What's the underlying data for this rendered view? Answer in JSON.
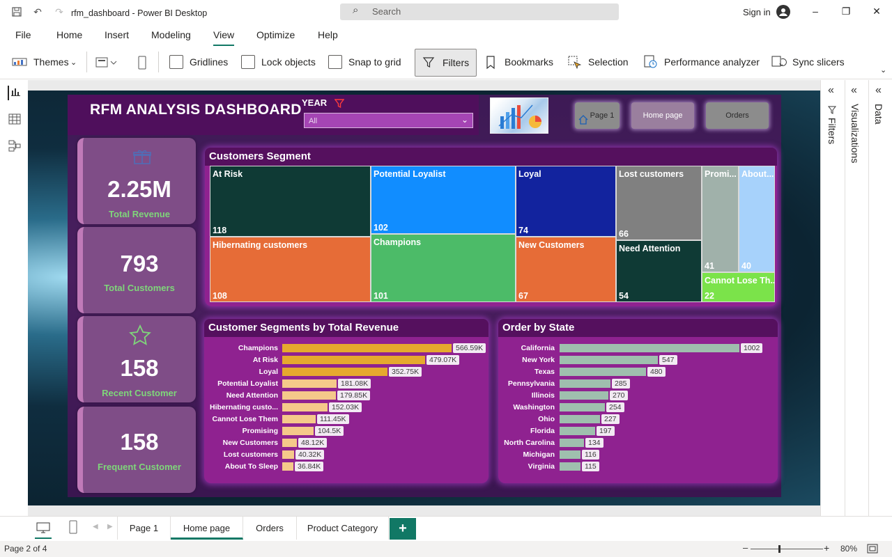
{
  "window": {
    "title": "rfm_dashboard - Power BI Desktop",
    "search_placeholder": "Search",
    "sign_in": "Sign in"
  },
  "menu": [
    "File",
    "Home",
    "Insert",
    "Modeling",
    "View",
    "Optimize",
    "Help"
  ],
  "menu_active": "View",
  "ribbon": {
    "themes": "Themes",
    "gridlines": "Gridlines",
    "lock_objects": "Lock objects",
    "snap_to_grid": "Snap to grid",
    "filters": "Filters",
    "bookmarks": "Bookmarks",
    "selection": "Selection",
    "performance_analyzer": "Performance analyzer",
    "sync_slicers": "Sync slicers"
  },
  "dashboard": {
    "title": "RFM ANALYSIS DASHBOARD",
    "year_label": "YEAR",
    "year_value": "All",
    "nav_buttons": [
      "Page 1",
      "Home page",
      "Orders"
    ],
    "kpis": [
      {
        "value": "2.25M",
        "label": "Total Revenue",
        "icon": "gift-icon"
      },
      {
        "value": "793",
        "label": "Total Customers"
      },
      {
        "value": "158",
        "label": "Recent Customer",
        "icon": "star-icon"
      },
      {
        "value": "158",
        "label": "Frequent Customer"
      }
    ],
    "treemap_title": "Customers Segment",
    "segments": [
      {
        "name": "At Risk",
        "count": "118",
        "color": "#0f3a35"
      },
      {
        "name": "Hibernating customers",
        "count": "108",
        "color": "#e66c37"
      },
      {
        "name": "Potential Loyalist",
        "count": "102",
        "color": "#118dff"
      },
      {
        "name": "Champions",
        "count": "101",
        "color": "#4cbb68"
      },
      {
        "name": "Loyal",
        "count": "74",
        "color": "#12239e"
      },
      {
        "name": "New Customers",
        "count": "67",
        "color": "#e66c37"
      },
      {
        "name": "Lost customers",
        "count": "66",
        "color": "#808080"
      },
      {
        "name": "Need Attention",
        "count": "54",
        "color": "#0f3a35"
      },
      {
        "name": "Promi...",
        "count": "41",
        "color": "#a0b1aa"
      },
      {
        "name": "About...",
        "count": "40",
        "color": "#a7d2fb"
      },
      {
        "name": "Cannot Lose Th...",
        "count": "22",
        "color": "#7be34a"
      }
    ],
    "revenue_title": "Customer Segments by Total Revenue",
    "state_title": "Order by State"
  },
  "chart_data": [
    {
      "type": "bar",
      "title": "Customer Segments by Total Revenue",
      "categories": [
        "Champions",
        "At Risk",
        "Loyal",
        "Potential Loyalist",
        "Need Attention",
        "Hibernating custo...",
        "Cannot Lose Them",
        "Promising",
        "New Customers",
        "Lost customers",
        "About To Sleep"
      ],
      "values": [
        566.59,
        479.07,
        352.75,
        181.08,
        179.85,
        152.03,
        111.45,
        104.5,
        48.12,
        40.32,
        36.84
      ],
      "labels": [
        "566.59K",
        "479.07K",
        "352.75K",
        "181.08K",
        "179.85K",
        "152.03K",
        "111.45K",
        "104.5K",
        "48.12K",
        "40.32K",
        "36.84K"
      ],
      "colors": [
        "#e6a92e",
        "#e6a92e",
        "#e6a92e",
        "#f5c98a",
        "#f5c98a",
        "#f5c98a",
        "#f5c98a",
        "#f5c98a",
        "#f5c98a",
        "#f5c98a",
        "#f5c98a"
      ]
    },
    {
      "type": "bar",
      "title": "Order by State",
      "categories": [
        "California",
        "New York",
        "Texas",
        "Pennsylvania",
        "Illinois",
        "Washington",
        "Ohio",
        "Florida",
        "North Carolina",
        "Michigan",
        "Virginia"
      ],
      "values": [
        1002,
        547,
        480,
        285,
        270,
        254,
        227,
        197,
        134,
        116,
        115
      ],
      "labels": [
        "1002",
        "547",
        "480",
        "285",
        "270",
        "254",
        "227",
        "197",
        "134",
        "116",
        "115"
      ],
      "colors": [
        "#9fbfae"
      ]
    }
  ],
  "page_tabs": [
    "Page 1",
    "Home page",
    "Orders",
    "Product Category"
  ],
  "page_tab_active": "Home page",
  "right_panes": [
    "Filters",
    "Visualizations",
    "Data"
  ],
  "status": {
    "page": "Page 2 of 4",
    "zoom": "80%"
  }
}
